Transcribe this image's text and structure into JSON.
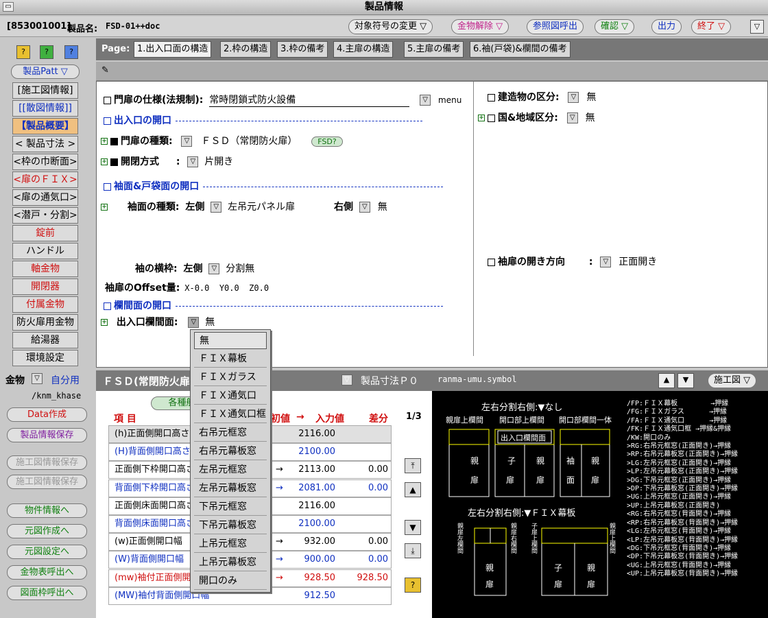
{
  "window_title": "製品情報",
  "info": {
    "code": "[853001001]",
    "name_label": "製品名:",
    "name_value": "FSD-01++doc",
    "buttons": [
      "対象符号の変更",
      "金物解除",
      "参照図呼出",
      "確認",
      "出力",
      "終了"
    ]
  },
  "sidebar": {
    "help_buttons": [
      "?",
      "?",
      "?"
    ],
    "patt_label": "製品Patt",
    "items": [
      {
        "label": "[施工図情報]",
        "color": "black"
      },
      {
        "label": "[[散図情報]]",
        "color": "blue"
      },
      {
        "label": "【製品概要】",
        "color": "blue"
      },
      {
        "label": "< 製品寸法 >",
        "color": "black"
      },
      {
        "label": "<枠の巾断面>",
        "color": "black"
      },
      {
        "label": "<扉のＦＩＸ>",
        "color": "red"
      },
      {
        "label": "<扉の通気口>",
        "color": "black"
      },
      {
        "label": "<潜戸・分割>",
        "color": "black"
      },
      {
        "label": "錠前",
        "color": "red"
      },
      {
        "label": "ハンドル",
        "color": "black"
      },
      {
        "label": "軸金物",
        "color": "red"
      },
      {
        "label": "開閉器",
        "color": "red"
      },
      {
        "label": "付属金物",
        "color": "red"
      },
      {
        "label": "防火扉用金物",
        "color": "black"
      },
      {
        "label": "給湯器",
        "color": "black"
      },
      {
        "label": "環境設定",
        "color": "black"
      }
    ],
    "kanamono_label": "金物",
    "jibun_label": "自分用",
    "path": "/knm_khase",
    "round_buttons": [
      {
        "label": "Data作成",
        "color": "red"
      },
      {
        "label": "製品情報保存",
        "color": "purple"
      },
      {
        "label": "施工図情報保存",
        "color": "gray"
      },
      {
        "label": "施工図情報保存",
        "color": "gray"
      },
      {
        "label": "物件情報へ",
        "color": "green"
      },
      {
        "label": "元図作成へ",
        "color": "green"
      },
      {
        "label": "元図設定へ",
        "color": "green"
      },
      {
        "label": "金物表呼出へ",
        "color": "green"
      },
      {
        "label": "図面枠呼出へ",
        "color": "green"
      }
    ]
  },
  "page_label": "Page:",
  "tabs": [
    "1.出入口面の構造",
    "2.枠の構造",
    "3.枠の備考",
    "4.主扉の構造",
    "5.主扉の備考",
    "6.袖(戸袋)&欄間の備考"
  ],
  "main": {
    "spec_label": "門扉の仕様(法規制):",
    "spec_value": "常時閉鎖式防火設備",
    "menu": "menu",
    "sect1": "出入口の開口",
    "door_type_label": "門扉の種類:",
    "door_type_value": "ＦＳＤ（常閉防火扉）",
    "fsd_btn": "FSD?",
    "open_label": "開閉方式",
    "open_value": "片開き",
    "sect2": "袖面&戸袋面の開口",
    "sode_label": "袖面の種類:",
    "left": "左側",
    "sode_left_value": "左吊元パネル扉",
    "right": "右側",
    "sode_right_value": "無",
    "waku_label": "袖の横枠:",
    "waku_left": "左側",
    "waku_value": "分割無",
    "offset_label": "袖扉のOffset量:",
    "offset_value": "X-0.0  Y0.0  Z0.0",
    "sect3": "欄間面の開口",
    "ranma_label": "出入口欄間面:",
    "ranma_value": "無",
    "bld_label": "建造物の区分:",
    "bld_value": "無",
    "region_label": "国&地域区分:",
    "region_value": "無",
    "sode_dir_label": "袖扉の開き方向",
    "sode_dir_value": "正面開き"
  },
  "dropdown": [
    "無",
    "ＦＩＸ幕板",
    "ＦＩＸガラス",
    "ＦＩＸ通気口",
    "ＦＩＸ通気口框",
    "右吊元框窓",
    "右吊元幕板窓",
    "左吊元框窓",
    "左吊元幕板窓",
    "下吊元框窓",
    "下吊元幕板窓",
    "上吊元框窓",
    "上吊元幕板窓",
    "開口のみ"
  ],
  "bottom": {
    "title": "ＦＳＤ(常閉防火扉",
    "dim_label": "製品寸法Ｐ０",
    "kakushu": "各種般",
    "col_item": "項 目",
    "col_init": "初値",
    "arrow": "→",
    "col_input": "入力値",
    "col_diff": "差分",
    "page": "1/3",
    "rows": [
      {
        "name": "(h)正面側開口高さ",
        "v1": "2116.00",
        "v2": "",
        "color": "black",
        "shade": true
      },
      {
        "name": "(H)背面側開口高さ",
        "v1": "2100.00",
        "v2": "",
        "color": "blue"
      },
      {
        "name": "正面側下枠開口高さ",
        "pre": ".00",
        "v1": "2113.00",
        "v2": "0.00",
        "color": "black"
      },
      {
        "name": "背面側下枠開口高さ",
        "pre": ".00",
        "v1": "2081.00",
        "v2": "0.00",
        "color": "blue"
      },
      {
        "name": "正面側床面開口高さ",
        "v1": "2116.00",
        "v2": "",
        "color": "black"
      },
      {
        "name": "背面側床面開口高さ",
        "v1": "2100.00",
        "v2": "",
        "color": "blue"
      },
      {
        "name": "(w)正面側開口幅",
        "pre": ".00",
        "v1": "932.00",
        "v2": "0.00",
        "color": "black"
      },
      {
        "name": "(W)背面側開口幅",
        "pre": ".00",
        "v1": "900.00",
        "v2": "0.00",
        "color": "blue"
      },
      {
        "name": "(mw)袖付正面側開口幅",
        "pre": ".00",
        "v1": "928.50",
        "v2": "928.50",
        "color": "red"
      },
      {
        "name": "(MW)袖付背面側開口幅",
        "v1": "912.50",
        "v2": "",
        "color": "blue"
      }
    ]
  },
  "symbol": {
    "title": "ranma-umu.symbol",
    "sekou": "施工図",
    "top_caption": "左右分割右側:▼なし",
    "labels_top": [
      "親扉上欄間",
      "開口部上欄間",
      "開口部欄間一体"
    ],
    "ranma_box": "出入口欄間面",
    "door_texts": [
      "親",
      "扉",
      "子",
      "扉",
      "親",
      "扉",
      "袖",
      "面",
      "親",
      "扉"
    ],
    "bottom_caption": "左右分割右側:▼ＦＩＸ幕板",
    "bottom_labels": [
      "親扉左欄間",
      "親扉右欄間",
      "子扉上欄間",
      "親扉上欄間"
    ],
    "bottom_doors": [
      "親",
      "扉",
      "子",
      "扉",
      "親",
      "扉"
    ],
    "legend": "/FP:ＦＩＸ幕板        →押縁\n/FG:ＦＩＸガラス      →押縁\n/FA:ＦＩＸ通気口      →押縁\n/FK:ＦＩＸ通気口框 →押縁&押縁\n/KW:開口のみ\n>RG:右吊元框窓(正面開き)→押縁\n>RP:右吊元幕板窓(正面開き)→押縁\n>LG:左吊元框窓(正面開き)→押縁\n>LP:左吊元幕板窓(正面開き)→押縁\n>DG:下吊元框窓(正面開き)→押縁\n>DP:下吊元幕板窓(正面開き)→押縁\n>UG:上吊元框窓(正面開き)→押縁\n>UP:上吊元幕板窓(正面開き)\n<RG:右吊元框窓(背面開き)→押縁\n<RP:右吊元幕板窓(背面開き)→押縁\n<LG:左吊元框窓(背面開き)→押縁\n<LP:左吊元幕板窓(背面開き)→押縁\n<DG:下吊元框窓(背面開き)→押縁\n<DP:下吊元幕板窓(背面開き)→押縁\n<UG:上吊元框窓(背面開き)→押縁\n<UP:上吊元幕板窓(背面開き)→押縁"
  }
}
